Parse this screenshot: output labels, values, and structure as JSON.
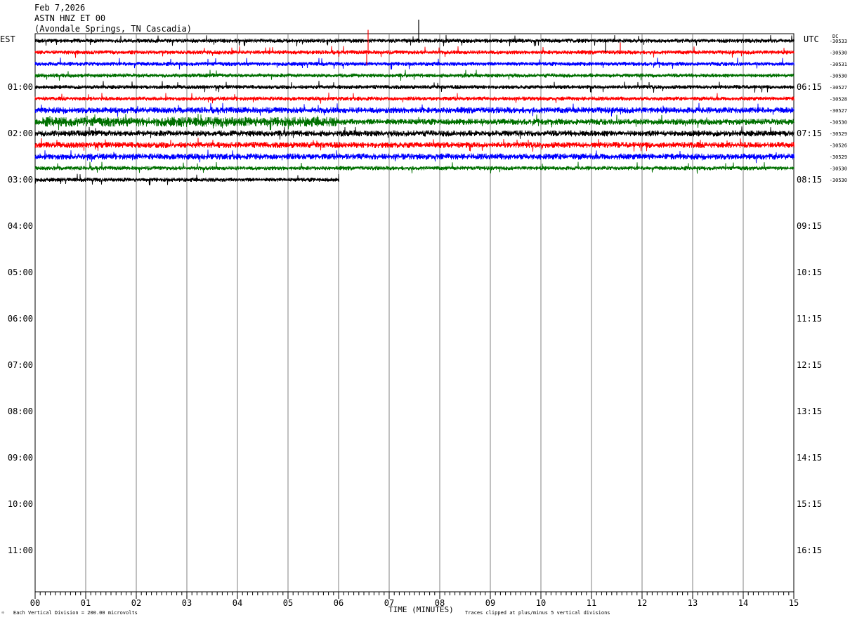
{
  "header": {
    "date": "Feb 7,2026",
    "station": "ASTN HNZ ET 00",
    "location": "(Avondale Springs, TN Cascadia)"
  },
  "left_zone": "EST",
  "right_zone": "UTC",
  "dc_label": "DC",
  "footer": {
    "scale": "Each Vertical Division =  200.00 microvolts",
    "clip": "Traces clipped at plus/minus 5 vertical divisions"
  },
  "chart_data": {
    "type": "line",
    "title": "",
    "xlabel": "TIME (MINUTES)",
    "ylabel": "",
    "xlim": [
      0,
      15
    ],
    "x_ticks": [
      "00",
      "01",
      "02",
      "03",
      "04",
      "05",
      "06",
      "07",
      "08",
      "09",
      "10",
      "11",
      "12",
      "13",
      "14",
      "15"
    ],
    "left_hour_labels": [
      "01:00",
      "02:00",
      "03:00",
      "04:00",
      "05:00",
      "06:00",
      "07:00",
      "08:00",
      "09:00",
      "10:00",
      "11:00"
    ],
    "right_hour_labels": [
      "06:15",
      "07:15",
      "08:15",
      "09:15",
      "10:15",
      "11:15",
      "12:15",
      "13:15",
      "14:15",
      "15:15",
      "16:15"
    ],
    "trace_colors": [
      "#000000",
      "#ff0000",
      "#0000ff",
      "#007000"
    ],
    "dc_offsets": [
      "-30533",
      "-30530",
      "-30531",
      "-30530",
      "-30527",
      "-30528",
      "-30527",
      "-30530",
      "-30529",
      "-30526",
      "-30529",
      "-30530",
      "-30530"
    ],
    "traces_rows": 13,
    "last_trace_end_minute": 6.0
  }
}
